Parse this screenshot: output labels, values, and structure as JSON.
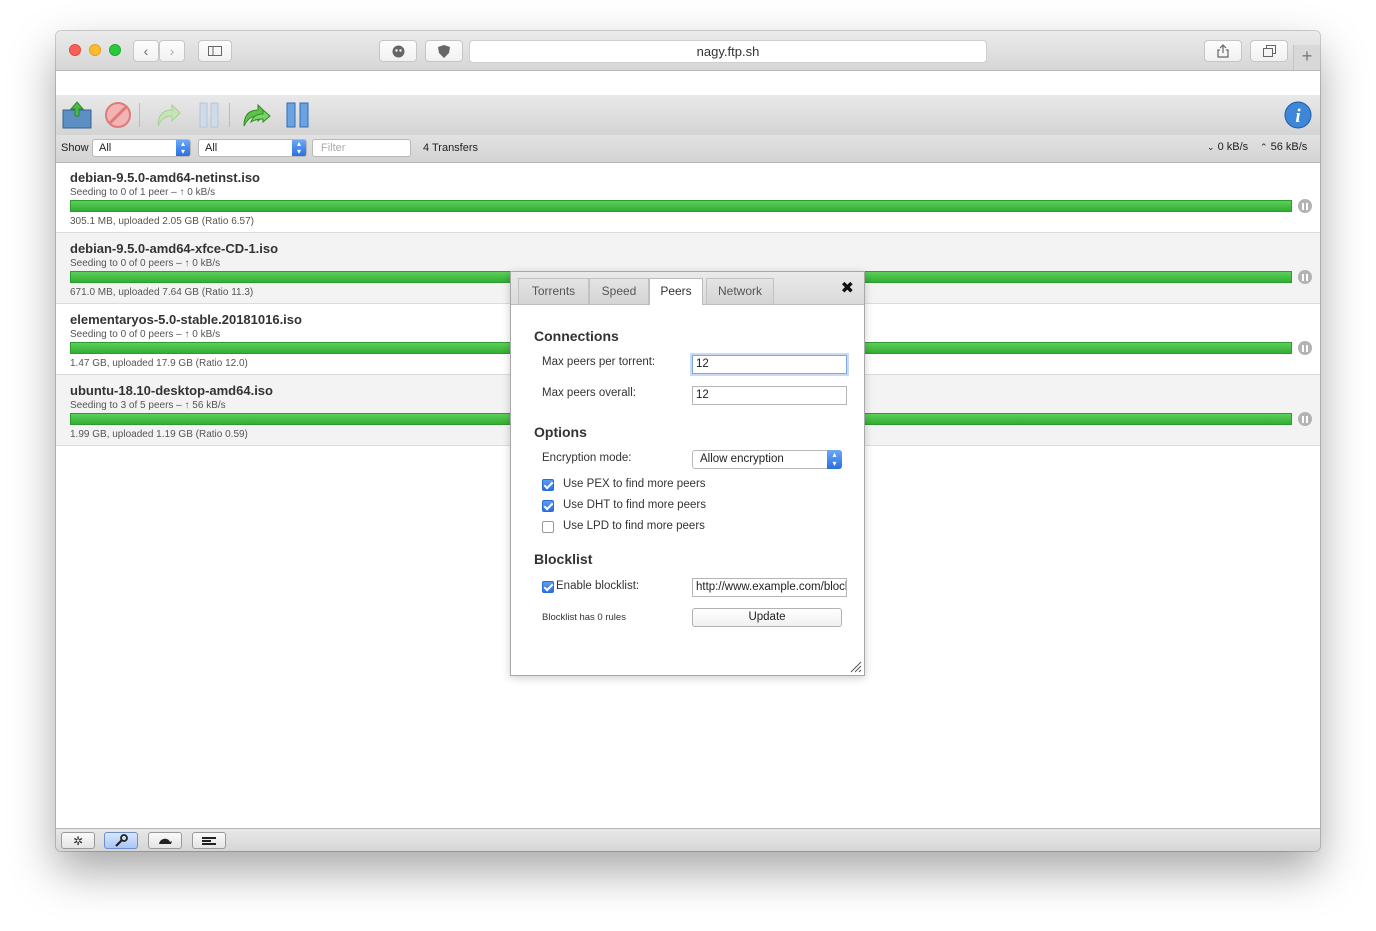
{
  "browser": {
    "url": "nagy.ftp.sh",
    "new_tab": "+"
  },
  "filterbar": {
    "show_label": "Show",
    "filter1": "All",
    "filter2": "All",
    "filter_placeholder": "Filter",
    "transfers": "4 Transfers",
    "down_speed": "0 kB/s",
    "up_speed": "56 kB/s"
  },
  "torrents": [
    {
      "name": "debian-9.5.0-amd64-netinst.iso",
      "peers": "Seeding to 0 of 1 peer – ↑ 0 kB/s",
      "stats": "305.1 MB, uploaded 2.05 GB (Ratio 6.57)",
      "progress": 1.0
    },
    {
      "name": "debian-9.5.0-amd64-xfce-CD-1.iso",
      "peers": "Seeding to 0 of 0 peers – ↑ 0 kB/s",
      "stats": "671.0 MB, uploaded 7.64 GB (Ratio 11.3)",
      "progress": 1.0
    },
    {
      "name": "elementaryos-5.0-stable.20181016.iso",
      "peers": "Seeding to 0 of 0 peers – ↑ 0 kB/s",
      "stats": "1.47 GB, uploaded 17.9 GB (Ratio 12.0)",
      "progress": 1.0
    },
    {
      "name": "ubuntu-18.10-desktop-amd64.iso",
      "peers": "Seeding to 3 of 5 peers – ↑ 56 kB/s",
      "stats": "1.99 GB, uploaded 1.19 GB (Ratio 0.59)",
      "progress": 1.0
    }
  ],
  "dialog": {
    "tabs": [
      "Torrents",
      "Speed",
      "Peers",
      "Network"
    ],
    "active_tab": "Peers",
    "close": "✖",
    "connections": {
      "title": "Connections",
      "max_per_torrent_label": "Max peers per torrent:",
      "max_per_torrent_value": "12",
      "max_overall_label": "Max peers overall:",
      "max_overall_value": "12"
    },
    "options": {
      "title": "Options",
      "encryption_label": "Encryption mode:",
      "encryption_value": "Allow encryption",
      "pex": {
        "label": "Use PEX to find more peers",
        "checked": true
      },
      "dht": {
        "label": "Use DHT to find more peers",
        "checked": true
      },
      "lpd": {
        "label": "Use LPD to find more peers",
        "checked": false
      }
    },
    "blocklist": {
      "title": "Blocklist",
      "enable_label": "Enable blocklist:",
      "enabled": true,
      "url": "http://www.example.com/blocklist",
      "rules_text": "Blocklist has 0 rules",
      "update_label": "Update"
    }
  },
  "colors": {
    "progress_green": "#3cb93c",
    "accent_blue": "#2a6fde"
  }
}
